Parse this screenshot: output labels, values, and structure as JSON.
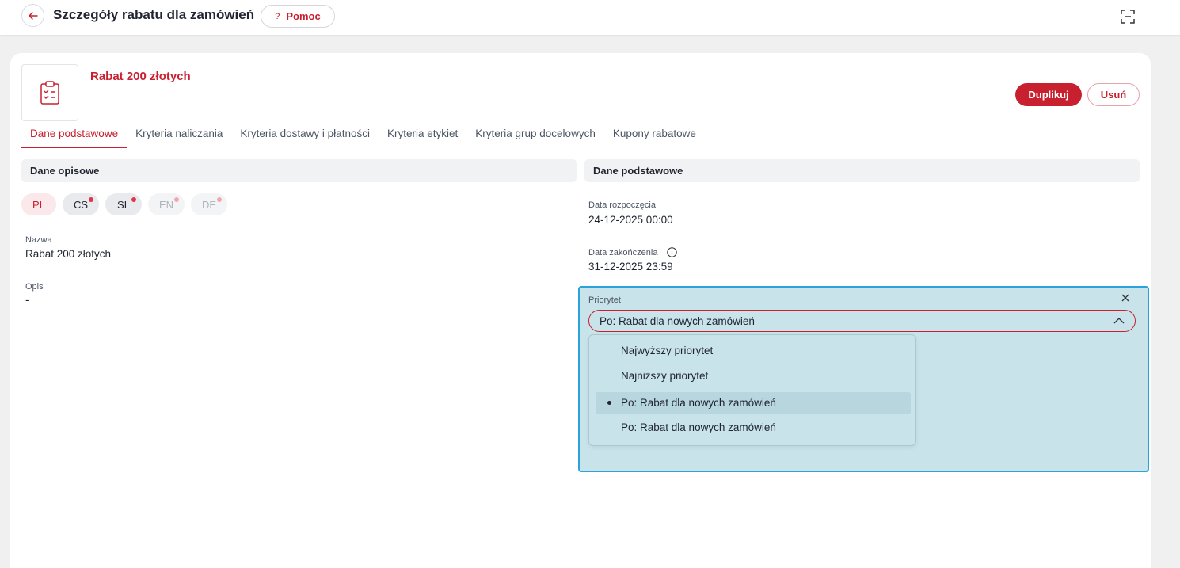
{
  "header": {
    "title": "Szczegóły rabatu dla zamówień",
    "help_q": "?",
    "help_label": "Pomoc"
  },
  "item": {
    "title": "Rabat 200 złotych",
    "duplicate_label": "Duplikuj",
    "delete_label": "Usuń"
  },
  "tabs": [
    {
      "label": "Dane podstawowe",
      "active": true
    },
    {
      "label": "Kryteria naliczania"
    },
    {
      "label": "Kryteria dostawy i płatności"
    },
    {
      "label": "Kryteria etykiet"
    },
    {
      "label": "Kryteria grup docelowych"
    },
    {
      "label": "Kupony rabatowe"
    }
  ],
  "left": {
    "section_title": "Dane opisowe",
    "languages": [
      {
        "code": "PL",
        "state": "active"
      },
      {
        "code": "CS",
        "state": "normal",
        "dot": true
      },
      {
        "code": "SL",
        "state": "normal",
        "dot": true
      },
      {
        "code": "EN",
        "state": "faded",
        "dot": true
      },
      {
        "code": "DE",
        "state": "faded",
        "dot": true
      }
    ],
    "name_label": "Nazwa",
    "name_value": "Rabat 200 złotych",
    "desc_label": "Opis",
    "desc_value": "-"
  },
  "right": {
    "section_title": "Dane podstawowe",
    "start_label": "Data rozpoczęcia",
    "start_value": "24-12-2025 00:00",
    "end_label": "Data zakończenia",
    "end_value": "31-12-2025 23:59",
    "priority_label": "Priorytet",
    "priority_value": "Po: Rabat dla nowych zamówień",
    "priority_options": [
      {
        "label": "Najwyższy priorytet"
      },
      {
        "label": "Najniższy priorytet"
      },
      {
        "label": "Po: Rabat dla nowych zamówień",
        "selected": true
      },
      {
        "label": "Po: Rabat dla nowych zamówień"
      }
    ]
  },
  "colors": {
    "accent": "#c8202f",
    "overlay": "#c8e3ea",
    "overlay_border": "#2aa3da"
  }
}
